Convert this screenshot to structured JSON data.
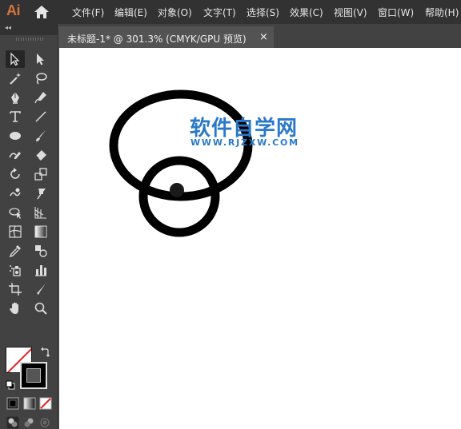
{
  "app": {
    "logo": "Ai"
  },
  "menu": [
    "文件(F)",
    "编辑(E)",
    "对象(O)",
    "文字(T)",
    "选择(S)",
    "效果(C)",
    "视图(V)",
    "窗口(W)",
    "帮助(H)"
  ],
  "document_tab": {
    "title": "未标题-1* @ 301.3% (CMYK/GPU 预览)",
    "close": "×"
  },
  "toolbar": {
    "collapse_glyph": "◂◂"
  },
  "watermark": {
    "title": "软件自学网",
    "url": "WWW.RJZXW.COM"
  },
  "colors": {
    "menubar": "#323232",
    "panel": "#424242",
    "canvas": "#ffffff",
    "logo": "#d4733a",
    "watermark": "#2a79c9",
    "stroke": "#000000",
    "none_slash": "#e02020"
  },
  "icons": [
    "home-icon",
    "selection-tool-icon",
    "direct-selection-tool-icon",
    "magic-wand-tool-icon",
    "lasso-tool-icon",
    "pen-tool-icon",
    "curvature-tool-icon",
    "type-tool-icon",
    "line-segment-tool-icon",
    "ellipse-tool-icon",
    "paintbrush-tool-icon",
    "shaper-tool-icon",
    "eraser-tool-icon",
    "rotate-tool-icon",
    "scale-tool-icon",
    "warp-tool-icon",
    "puppet-warp-tool-icon",
    "shape-builder-tool-icon",
    "perspective-grid-tool-icon",
    "mesh-tool-icon",
    "gradient-tool-icon",
    "eyedropper-tool-icon",
    "blend-tool-icon",
    "symbol-sprayer-tool-icon",
    "column-graph-tool-icon",
    "artboard-tool-icon",
    "slice-tool-icon",
    "hand-tool-icon",
    "zoom-tool-icon",
    "swap-fill-stroke-icon",
    "default-colors-icon",
    "color-mode-icon",
    "gradient-mode-icon",
    "none-mode-icon",
    "draw-normal-icon",
    "draw-behind-icon",
    "draw-inside-icon",
    "screen-mode-icon"
  ]
}
